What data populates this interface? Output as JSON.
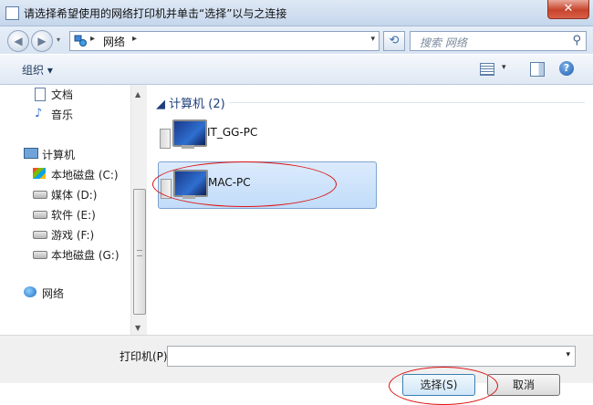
{
  "window": {
    "title": "请选择希望使用的网络打印机并单击“选择”以与之连接",
    "close_label": "✕"
  },
  "navbar": {
    "back_icon": "back-arrow-icon",
    "forward_icon": "forward-arrow-icon",
    "address_sep": "▸",
    "address_text": "网络",
    "address_trail": "▸",
    "dropdown_glyph": "▾",
    "refresh_glyph": "⟲",
    "search_placeholder": "搜索 网络",
    "search_glyph": "⚲"
  },
  "toolbar": {
    "organize_label": "组织 ▾",
    "view_drop": "▾",
    "help_glyph": "?"
  },
  "sidebar": {
    "items": [
      {
        "label": "文档",
        "icon": "document-icon"
      },
      {
        "label": "音乐",
        "icon": "music-icon"
      },
      {
        "label": "计算机",
        "icon": "computer-icon"
      },
      {
        "label": "本地磁盘 (C:)",
        "icon": "windows-drive-icon"
      },
      {
        "label": "媒体 (D:)",
        "icon": "drive-icon"
      },
      {
        "label": "软件 (E:)",
        "icon": "drive-icon"
      },
      {
        "label": "游戏 (F:)",
        "icon": "drive-icon"
      },
      {
        "label": "本地磁盘 (G:)",
        "icon": "drive-icon"
      },
      {
        "label": "网络",
        "icon": "network-icon"
      }
    ],
    "scroll_up": "▲",
    "scroll_down": "▼"
  },
  "content": {
    "group_header": "◢ 计算机 (2)",
    "computers": [
      {
        "name": "IT_GG-PC",
        "selected": false
      },
      {
        "name": "MAC-PC",
        "selected": true
      }
    ]
  },
  "bottom": {
    "printer_label": "打印机(P)",
    "printer_value": "",
    "printer_drop": "▾",
    "select_label": "选择(S)",
    "cancel_label": "取消"
  },
  "colors": {
    "highlight": "#c1dcfa",
    "annotation": "#dd1111"
  }
}
